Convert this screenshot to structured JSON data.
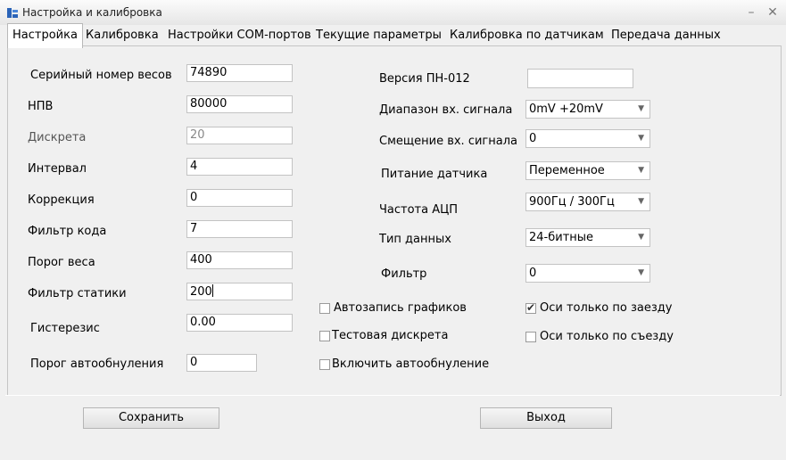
{
  "window": {
    "title": "Настройка и калибровка",
    "minimize": "–",
    "close": "✕"
  },
  "tabs": [
    {
      "label": "Настройка"
    },
    {
      "label": "Калибровка"
    },
    {
      "label": "Настройки COM-портов"
    },
    {
      "label": "Текущие параметры"
    },
    {
      "label": "Калибровка по датчикам"
    },
    {
      "label": "Передача данных"
    }
  ],
  "left_fields": [
    {
      "label": "Серийный номер весов",
      "value": "74890"
    },
    {
      "label": "НПВ",
      "value": "80000"
    },
    {
      "label": "Дискрета",
      "value": "20"
    },
    {
      "label": "Интервал",
      "value": "4"
    },
    {
      "label": "Коррекция",
      "value": "0"
    },
    {
      "label": "Фильтр кода",
      "value": "7"
    },
    {
      "label": "Порог веса",
      "value": "400"
    },
    {
      "label": "Фильтр статики",
      "value": "200"
    },
    {
      "label": "Гистерезис",
      "value": "0.00"
    },
    {
      "label": "Порог автообнуления",
      "value": "0"
    }
  ],
  "right_fields": {
    "version": {
      "label": "Версия ПН-012",
      "value": ""
    },
    "combos": [
      {
        "label": "Диапазон вх. сигнала",
        "value": "0mV +20mV"
      },
      {
        "label": "Смещение вх. сигнала",
        "value": "0"
      },
      {
        "label": "Питание датчика",
        "value": "Переменное"
      },
      {
        "label": "Частота АЦП",
        "value": "900Гц / 300Гц"
      },
      {
        "label": "Тип данных",
        "value": "24-битные"
      },
      {
        "label": "Фильтр",
        "value": "0"
      }
    ]
  },
  "checkboxes": [
    {
      "label": "Автозапись графиков",
      "checked": false
    },
    {
      "label": "Тестовая дискрета",
      "checked": false
    },
    {
      "label": "Включить автообнуление",
      "checked": false
    },
    {
      "label": "Оси только по заезду",
      "checked": true
    },
    {
      "label": "Оси только по съезду",
      "checked": false
    }
  ],
  "buttons": {
    "save": "Сохранить",
    "exit": "Выход"
  },
  "check_glyph": "✔",
  "dropdown_glyph": "▼"
}
